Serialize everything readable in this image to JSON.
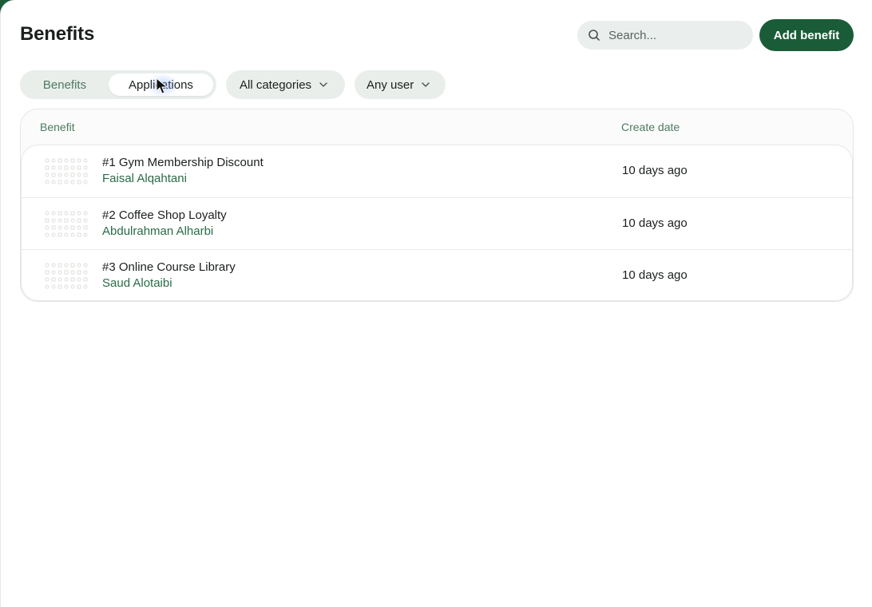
{
  "page": {
    "title": "Benefits"
  },
  "search": {
    "placeholder": "Search..."
  },
  "actions": {
    "add_label": "Add benefit"
  },
  "tabs": [
    {
      "label": "Benefits",
      "active": false
    },
    {
      "label": "Applications",
      "active": true
    }
  ],
  "filters": {
    "category": "All categories",
    "user": "Any user"
  },
  "table": {
    "columns": [
      "Benefit",
      "Create date"
    ],
    "rows": [
      {
        "name": "#1 Gym Membership Discount",
        "user": "Faisal Alqahtani",
        "date": "10 days ago"
      },
      {
        "name": "#2 Coffee Shop Loyalty",
        "user": "Abdulrahman Alharbi",
        "date": "10 days ago"
      },
      {
        "name": "#3 Online Course Library",
        "user": "Saud Alotaibi",
        "date": "10 days ago"
      }
    ]
  },
  "colors": {
    "accent": "#1a5c38",
    "link": "#2a6b47",
    "muted_green": "#4e7a62",
    "pill_bg": "#e9eeeb"
  },
  "icons": {
    "search": "search-icon",
    "chevron": "chevron-down-icon",
    "thumbnail": "benefit-thumbnail-icon"
  }
}
